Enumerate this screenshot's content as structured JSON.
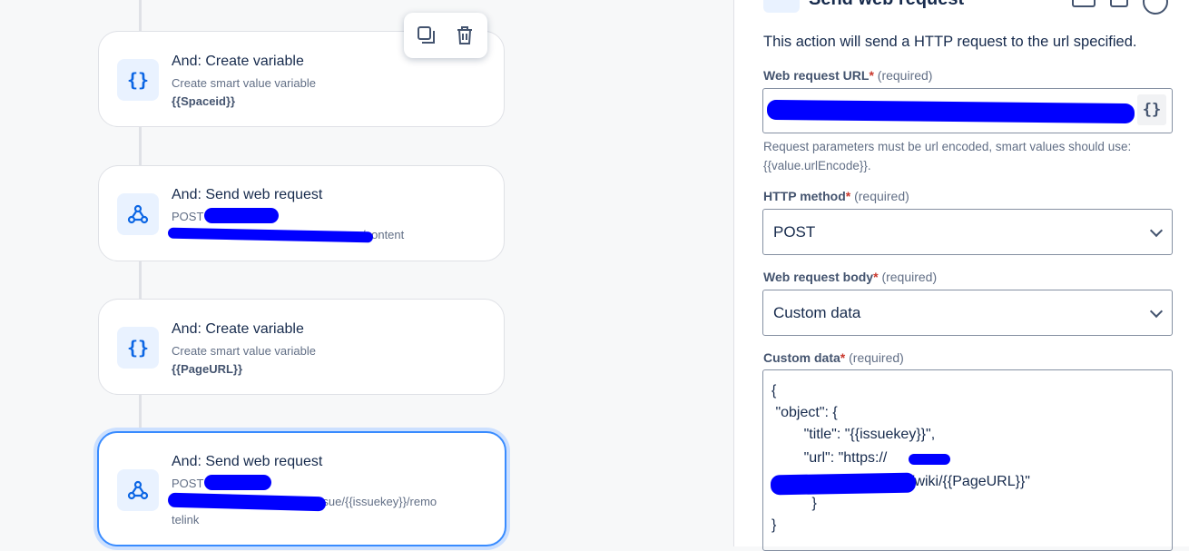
{
  "flow": {
    "cards": [
      {
        "title": "And: Create variable",
        "subtitle": "Create smart value variable",
        "value": "{{Spaceid}}",
        "icon": "curly-braces-icon"
      },
      {
        "title": "And: Send web request",
        "subtitle": "POST",
        "value": "/content",
        "icon": "webhook-icon"
      },
      {
        "title": "And: Create variable",
        "subtitle": "Create smart value variable",
        "value": "{{PageURL}}",
        "icon": "curly-braces-icon"
      },
      {
        "title": "And: Send web request",
        "subtitle": "POST",
        "value_line1": "t/api/3/issue/{{issuekey}}/remo",
        "value_line2": "telink",
        "icon": "webhook-icon"
      }
    ],
    "toolbar": {
      "duplicate_icon": "duplicate-icon",
      "delete_icon": "trash-icon"
    }
  },
  "panel": {
    "header_title": "Send web request",
    "description": "This action will send a HTTP request to the url specified.",
    "url_label": "Web request URL",
    "required_mark": "*",
    "required_text": "(required)",
    "smart_value_button": "{}",
    "url_help_line1": "Request parameters must be url encoded, smart values should use:",
    "url_help_line2": "{{value.urlEncode}}.",
    "method_label": "HTTP method",
    "method_value": "POST",
    "body_label": "Web request body",
    "body_value": "Custom data",
    "custom_label": "Custom data",
    "custom_lines": [
      "{",
      " \"object\": {",
      "        \"title\": \"{{issuekey}}\",",
      "        \"url\": \"https://",
      "/wiki/{{PageURL}}\"",
      "          }",
      "}"
    ]
  }
}
